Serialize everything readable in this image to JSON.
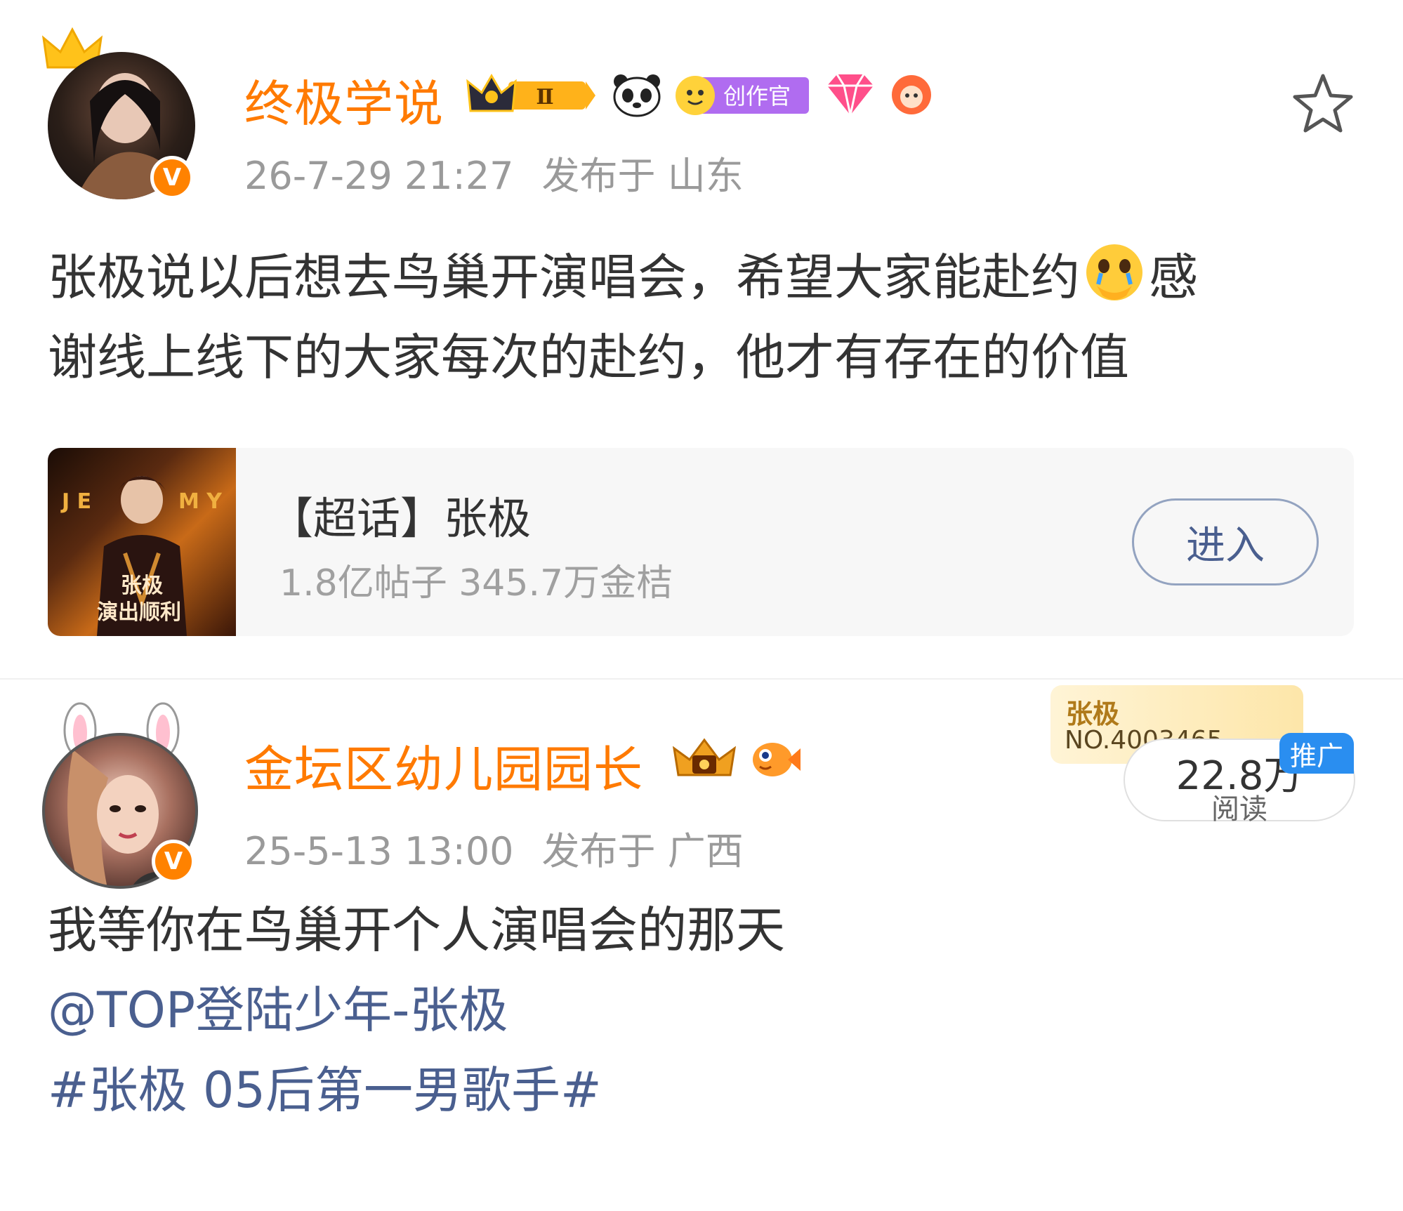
{
  "posts": [
    {
      "username": "终极学说",
      "timestamp": "26-7-29 21:27",
      "location": "发布于 山东",
      "text_part1": "张极说以后想去鸟巢开演唱会，希望大家能赴约",
      "text_part2": "感",
      "text_part3": "谢线上线下的大家每次的赴约，他才有存在的价值",
      "badges": [
        "crown-level-badge",
        "panda-icon",
        "creator-badge",
        "diamond-badge",
        "fan-circle-badge"
      ],
      "badge_texts": {
        "level": "Ⅱ",
        "creator": "创作官"
      },
      "verified": "V",
      "topic_card": {
        "title": "【超话】张极",
        "stats": "1.8亿帖子 345.7万金桔",
        "button": "进入",
        "thumb_lettering": "张极 演出顺利"
      }
    },
    {
      "username": "金坛区幼儿园园长",
      "timestamp": "25-5-13 13:00",
      "location": "发布于 广西",
      "text": "我等你在鸟巢开个人演唱会的那天",
      "mention": "@TOP登陆少年-张极",
      "hashtag": "#张极 05后第一男歌手#",
      "verified": "V",
      "fans_badge": {
        "name": "张极",
        "number": "NO.4003465"
      },
      "reads": {
        "count": "22.8万",
        "label": "阅读"
      },
      "promo": "推广"
    }
  ],
  "colors": {
    "username": "#ff7a00",
    "link": "#4a5f8f",
    "meta": "#9a9a9a",
    "verified": "#ff8200"
  }
}
